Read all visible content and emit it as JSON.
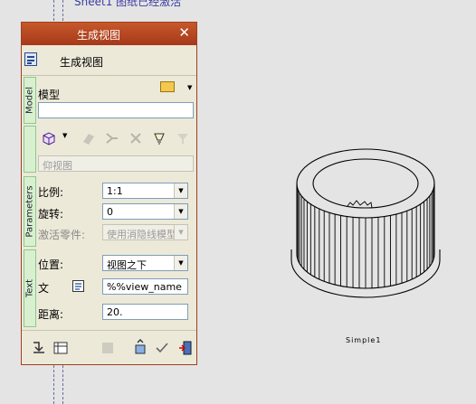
{
  "window": {
    "title": "生成视图",
    "close_glyph": "✕"
  },
  "header": {
    "label": "生成视图"
  },
  "background": {
    "top_note": "Sheet1 图纸已经激活",
    "view_caption": "Simple1"
  },
  "tabs": {
    "model": "Model",
    "parameters": "Parameters",
    "text": "Text"
  },
  "model": {
    "label": "模型",
    "path_value": "",
    "open_icon": "folder-open-icon"
  },
  "views": {
    "selected_view": "仰视图",
    "view_cube_icon": "view-cube-icon"
  },
  "parameters": {
    "scale_label": "比例:",
    "scale_value": "1:1",
    "rotation_label": "旋转:",
    "rotation_value": "0",
    "active_part_label": "激活零件:",
    "active_part_value": "使用消隐线模型"
  },
  "text": {
    "position_label": "位置:",
    "position_value": "视图之下",
    "text_label": "文",
    "text_value": "%%view_name",
    "distance_label": "距离:",
    "distance_value": "20."
  },
  "colors": {
    "title_bar": "#b4472a",
    "tab_green": "#d8f0d0",
    "panel": "#ece9d8"
  }
}
